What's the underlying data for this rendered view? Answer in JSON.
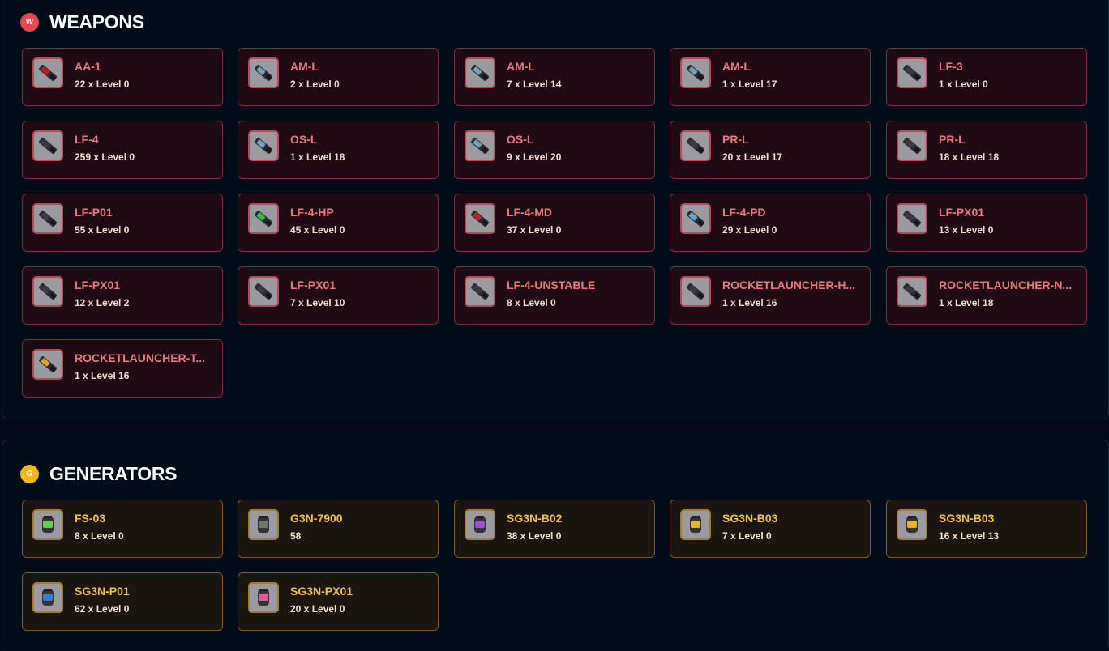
{
  "weapons": {
    "badge": "W",
    "title": "WEAPONS",
    "accent": "#e8474d",
    "items": [
      {
        "name": "AA-1",
        "count": "22 x Level 0",
        "icon": "red-blade-weapon-icon"
      },
      {
        "name": "AM-L",
        "count": "2 x Level 0",
        "icon": "laser-gun-icon"
      },
      {
        "name": "AM-L",
        "count": "7 x Level 14",
        "icon": "laser-gun-icon"
      },
      {
        "name": "AM-L",
        "count": "1 x Level 17",
        "icon": "laser-gun-icon"
      },
      {
        "name": "LF-3",
        "count": "1 x Level 0",
        "icon": "laser-cannon-icon"
      },
      {
        "name": "LF-4",
        "count": "259 x Level 0",
        "icon": "laser-cannon-icon"
      },
      {
        "name": "OS-L",
        "count": "1 x Level 18",
        "icon": "long-barrel-gun-icon"
      },
      {
        "name": "OS-L",
        "count": "9 x Level 20",
        "icon": "long-barrel-gun-icon"
      },
      {
        "name": "PR-L",
        "count": "20 x Level 17",
        "icon": "dark-claw-weapon-icon"
      },
      {
        "name": "PR-L",
        "count": "18 x Level 18",
        "icon": "dark-claw-weapon-icon"
      },
      {
        "name": "LF-P01",
        "count": "55 x Level 0",
        "icon": "laser-cannon-icon"
      },
      {
        "name": "LF-4-HP",
        "count": "45 x Level 0",
        "icon": "green-laser-cannon-icon"
      },
      {
        "name": "LF-4-MD",
        "count": "37 x Level 0",
        "icon": "red-laser-cannon-icon"
      },
      {
        "name": "LF-4-PD",
        "count": "29 x Level 0",
        "icon": "blue-laser-cannon-icon"
      },
      {
        "name": "LF-PX01",
        "count": "13 x Level 0",
        "icon": "laser-cannon-icon"
      },
      {
        "name": "LF-PX01",
        "count": "12 x Level 2",
        "icon": "laser-cannon-icon"
      },
      {
        "name": "LF-PX01",
        "count": "7 x Level 10",
        "icon": "laser-cannon-icon"
      },
      {
        "name": "LF-4-UNSTABLE",
        "count": "8 x Level 0",
        "icon": "dark-laser-cannon-icon"
      },
      {
        "name": "ROCKETLAUNCHER-H...",
        "count": "1 x Level 16",
        "icon": "rocket-launcher-icon"
      },
      {
        "name": "ROCKETLAUNCHER-N...",
        "count": "1 x Level 18",
        "icon": "rocket-launcher-icon"
      },
      {
        "name": "ROCKETLAUNCHER-T...",
        "count": "1 x Level 16",
        "icon": "gold-rocket-launcher-icon"
      }
    ]
  },
  "generators": {
    "badge": "G",
    "title": "GENERATORS",
    "accent": "#f0b81c",
    "items": [
      {
        "name": "FS-03",
        "count": "8 x Level 0",
        "icon": "green-generator-icon"
      },
      {
        "name": "G3N-7900",
        "count": "58",
        "icon": "gray-generator-icon"
      },
      {
        "name": "SG3N-B02",
        "count": "38 x Level 0",
        "icon": "purple-shield-generator-icon"
      },
      {
        "name": "SG3N-B03",
        "count": "7 x Level 0",
        "icon": "gold-shield-generator-icon"
      },
      {
        "name": "SG3N-B03",
        "count": "16 x Level 13",
        "icon": "gold-shield-generator-icon"
      },
      {
        "name": "SG3N-P01",
        "count": "62 x Level 0",
        "icon": "blue-shield-generator-icon"
      },
      {
        "name": "SG3N-PX01",
        "count": "20 x Level 0",
        "icon": "pink-shield-generator-icon"
      }
    ]
  }
}
